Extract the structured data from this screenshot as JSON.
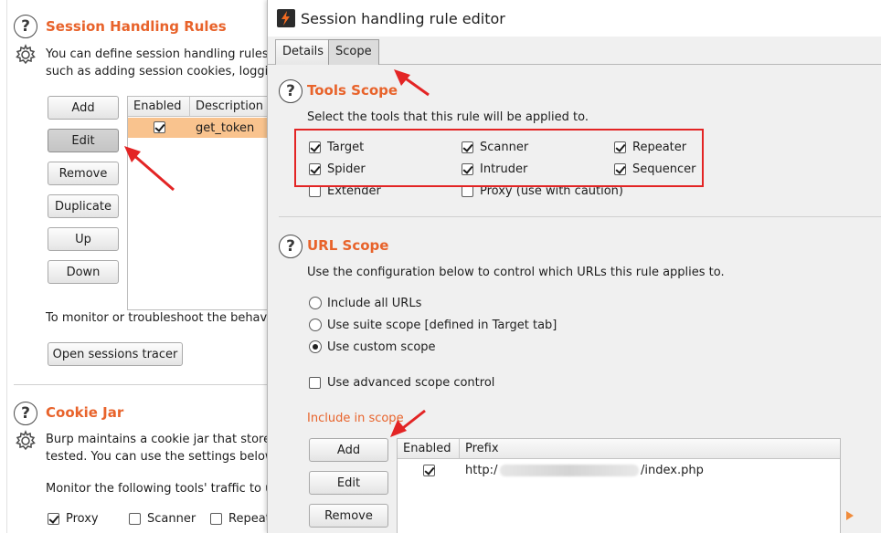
{
  "session_rules": {
    "title": "Session Handling Rules",
    "desc_line1": "You can define session handling rules to m",
    "desc_line2": "such as adding session cookies, logging i",
    "buttons": {
      "add": "Add",
      "edit": "Edit",
      "remove": "Remove",
      "duplicate": "Duplicate",
      "up": "Up",
      "down": "Down"
    },
    "table": {
      "columns": [
        "Enabled",
        "Description"
      ],
      "rows": [
        {
          "enabled": true,
          "description": "get_token"
        }
      ]
    },
    "monitor_text": "To monitor or troubleshoot the behavior of",
    "tracer_button": "Open sessions tracer"
  },
  "cookie_jar": {
    "title": "Cookie Jar",
    "desc_line1": "Burp maintains a cookie jar that stores all",
    "desc_line2": "tested. You can use the settings below to",
    "monitor_text": "Monitor the following tools' traffic to update",
    "tools": [
      {
        "label": "Proxy",
        "checked": true
      },
      {
        "label": "Scanner",
        "checked": false
      },
      {
        "label": "Repeat",
        "checked": false
      }
    ]
  },
  "editor": {
    "window_title": "Session handling rule editor",
    "tabs": [
      "Details",
      "Scope"
    ],
    "active_tab": "Scope",
    "tools_scope": {
      "title": "Tools Scope",
      "desc": "Select the tools that this rule will be applied to.",
      "tools": [
        {
          "label": "Target",
          "checked": true
        },
        {
          "label": "Scanner",
          "checked": true
        },
        {
          "label": "Repeater",
          "checked": true
        },
        {
          "label": "Spider",
          "checked": true
        },
        {
          "label": "Intruder",
          "checked": true
        },
        {
          "label": "Sequencer",
          "checked": true
        },
        {
          "label": "Extender",
          "checked": false
        },
        {
          "label": "Proxy (use with caution)",
          "checked": false
        }
      ]
    },
    "url_scope": {
      "title": "URL Scope",
      "desc": "Use the configuration below to control which URLs this rule applies to.",
      "options": [
        {
          "label": "Include all URLs",
          "selected": false
        },
        {
          "label": "Use suite scope [defined in Target tab]",
          "selected": false
        },
        {
          "label": "Use custom scope",
          "selected": true
        }
      ],
      "advanced_label": "Use advanced scope control",
      "include_label": "Include in scope",
      "buttons": {
        "add": "Add",
        "edit": "Edit",
        "remove": "Remove"
      },
      "table": {
        "columns": [
          "Enabled",
          "Prefix"
        ],
        "rows": [
          {
            "enabled": true,
            "prefix_start": "http:/",
            "prefix_end": "/index.php"
          }
        ]
      }
    }
  },
  "colors": {
    "accent": "#e8632b",
    "annotation": "#e32424",
    "selected_row": "#f9c38e"
  }
}
